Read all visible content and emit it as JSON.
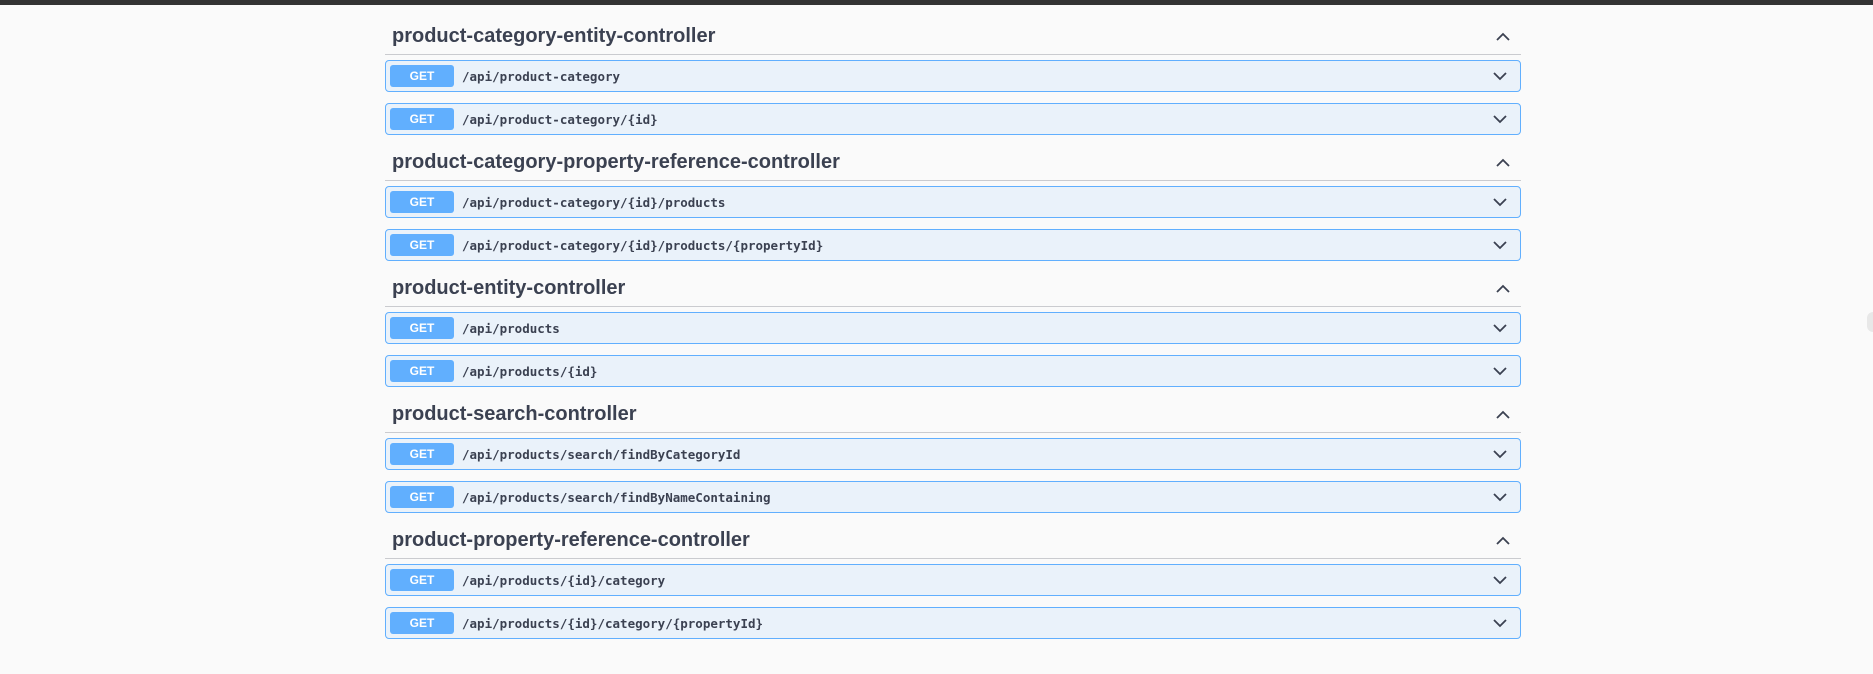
{
  "tags": [
    {
      "name": "product-category-entity-controller",
      "operations": [
        {
          "method": "GET",
          "path": "/api/product-category"
        },
        {
          "method": "GET",
          "path": "/api/product-category/{id}"
        }
      ]
    },
    {
      "name": "product-category-property-reference-controller",
      "operations": [
        {
          "method": "GET",
          "path": "/api/product-category/{id}/products"
        },
        {
          "method": "GET",
          "path": "/api/product-category/{id}/products/{propertyId}"
        }
      ]
    },
    {
      "name": "product-entity-controller",
      "operations": [
        {
          "method": "GET",
          "path": "/api/products"
        },
        {
          "method": "GET",
          "path": "/api/products/{id}"
        }
      ]
    },
    {
      "name": "product-search-controller",
      "operations": [
        {
          "method": "GET",
          "path": "/api/products/search/findByCategoryId"
        },
        {
          "method": "GET",
          "path": "/api/products/search/findByNameContaining"
        }
      ]
    },
    {
      "name": "product-property-reference-controller",
      "operations": [
        {
          "method": "GET",
          "path": "/api/products/{id}/category"
        },
        {
          "method": "GET",
          "path": "/api/products/{id}/category/{propertyId}"
        }
      ]
    }
  ],
  "icons": {
    "collapse": "chevron-up-icon",
    "expand": "chevron-down-icon"
  },
  "colors": {
    "get_method": "#61affe",
    "text": "#3b4151",
    "topbar": "#333333"
  }
}
